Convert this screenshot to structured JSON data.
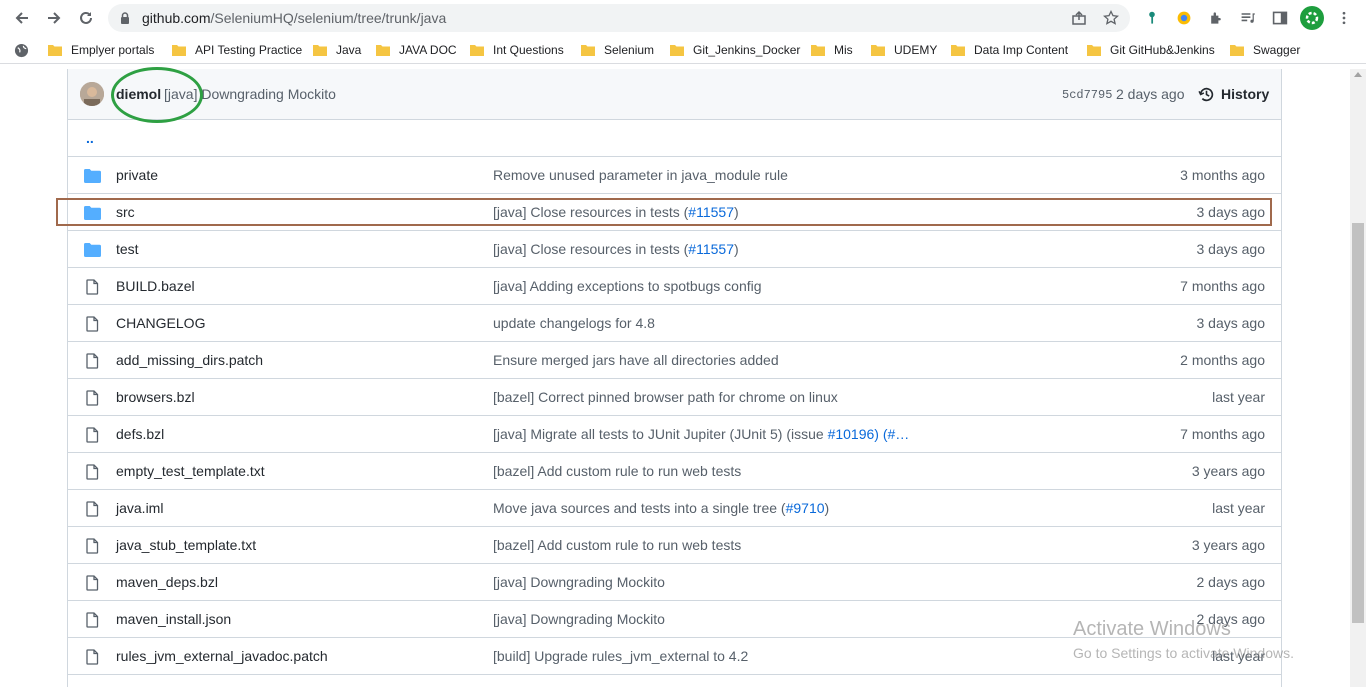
{
  "browser": {
    "url_host": "github.com",
    "url_path": "/SeleniumHQ/selenium/tree/trunk/java"
  },
  "bookmarks": [
    {
      "label": "Emplyer portals"
    },
    {
      "label": "API Testing Practice"
    },
    {
      "label": "Java"
    },
    {
      "label": "JAVA DOC"
    },
    {
      "label": "Int Questions"
    },
    {
      "label": "Selenium"
    },
    {
      "label": "Git_Jenkins_Docker"
    },
    {
      "label": "Mis"
    },
    {
      "label": "UDEMY"
    },
    {
      "label": "Data Imp Content"
    },
    {
      "label": "Git GitHub&Jenkins"
    },
    {
      "label": "Swagger"
    }
  ],
  "latest_commit": {
    "author": "diemol",
    "message": "[java] Downgrading Mockito",
    "sha": "5cd7795",
    "date": "2 days ago",
    "history_label": "History"
  },
  "parent_dir": "..",
  "files": [
    {
      "type": "dir",
      "name": "private",
      "message": "Remove unused parameter in java_module rule",
      "link": "",
      "suffix": "",
      "age": "3 months ago"
    },
    {
      "type": "dir",
      "name": "src",
      "message": "[java] Close resources in tests (",
      "link": "#11557",
      "suffix": ")",
      "age": "3 days ago"
    },
    {
      "type": "dir",
      "name": "test",
      "message": "[java] Close resources in tests (",
      "link": "#11557",
      "suffix": ")",
      "age": "3 days ago"
    },
    {
      "type": "file",
      "name": "BUILD.bazel",
      "message": "[java] Adding exceptions to spotbugs config",
      "link": "",
      "suffix": "",
      "age": "7 months ago"
    },
    {
      "type": "file",
      "name": "CHANGELOG",
      "message": "update changelogs for 4.8",
      "link": "",
      "suffix": "",
      "age": "3 days ago"
    },
    {
      "type": "file",
      "name": "add_missing_dirs.patch",
      "message": "Ensure merged jars have all directories added",
      "link": "",
      "suffix": "",
      "age": "2 months ago"
    },
    {
      "type": "file",
      "name": "browsers.bzl",
      "message": "[bazel] Correct pinned browser path for chrome on linux",
      "link": "",
      "suffix": "",
      "age": "last year"
    },
    {
      "type": "file",
      "name": "defs.bzl",
      "message": "[java] Migrate all tests to JUnit Jupiter (JUnit 5) (issue ",
      "link": "#10196",
      "suffix": ") (#…",
      "age": "7 months ago"
    },
    {
      "type": "file",
      "name": "empty_test_template.txt",
      "message": "[bazel] Add custom rule to run web tests",
      "link": "",
      "suffix": "",
      "age": "3 years ago"
    },
    {
      "type": "file",
      "name": "java.iml",
      "message": "Move java sources and tests into a single tree (",
      "link": "#9710",
      "suffix": ")",
      "age": "last year"
    },
    {
      "type": "file",
      "name": "java_stub_template.txt",
      "message": "[bazel] Add custom rule to run web tests",
      "link": "",
      "suffix": "",
      "age": "3 years ago"
    },
    {
      "type": "file",
      "name": "maven_deps.bzl",
      "message": "[java] Downgrading Mockito",
      "link": "",
      "suffix": "",
      "age": "2 days ago"
    },
    {
      "type": "file",
      "name": "maven_install.json",
      "message": "[java] Downgrading Mockito",
      "link": "",
      "suffix": "",
      "age": "2 days ago"
    },
    {
      "type": "file",
      "name": "rules_jvm_external_javadoc.patch",
      "message": "[build] Upgrade rules_jvm_external to 4.2",
      "link": "",
      "suffix": "",
      "age": "last year"
    }
  ],
  "watermark": {
    "line1": "Activate Windows",
    "line2": "Go to Settings to activate Windows."
  },
  "colors": {
    "folder": "#54aeff",
    "link": "#0969da",
    "highlight_box": "#a0694c",
    "annotation_circle": "#2ea043"
  }
}
